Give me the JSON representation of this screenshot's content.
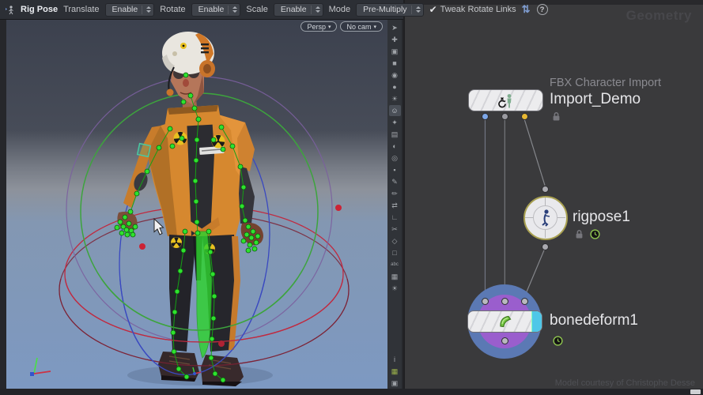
{
  "colors": {
    "toolbar_bg": "#2c2f35",
    "network_bg": "#3a3a3c",
    "watermark": "#47474b",
    "credit": "#4f5055",
    "wire": "#85878c",
    "dot_blue": "#7da7e8",
    "dot_gray": "#9a9aa0",
    "dot_yellow": "#e8b833",
    "node_blue": "#5b79b4",
    "node_purple": "#9a5ecd",
    "node_cyan": "#4fc7e8",
    "ring_olive": "#a8a050",
    "suit_orange": "#d6882f",
    "control_green": "#2ee22e",
    "ring_green": "#3da43d",
    "ring_red": "#c02a40",
    "ring_blue": "#3a49c0",
    "ring_purple": "#7b5f9e"
  },
  "toolbar": {
    "tool_label": "Rig Pose",
    "groups": [
      {
        "label": "Translate",
        "value": "Enable"
      },
      {
        "label": "Rotate",
        "value": "Enable"
      },
      {
        "label": "Scale",
        "value": "Enable"
      },
      {
        "label": "Mode",
        "value": "Pre-Multiply"
      }
    ],
    "tweak_checkbox": {
      "checked": true,
      "mark": "✔",
      "label": "Tweak Rotate Links"
    },
    "help_glyph": "?",
    "sort_glyph": "⇅"
  },
  "viewport": {
    "pills": [
      {
        "label": "Persp",
        "chevron": "▾"
      },
      {
        "label": "No cam",
        "chevron": "▾"
      }
    ],
    "right_toolbar": {
      "top": [
        {
          "name": "select-icon",
          "glyph": "➤"
        },
        {
          "name": "pan-view-icon",
          "glyph": "✚"
        },
        {
          "name": "zoom-region-icon",
          "glyph": "▣"
        },
        {
          "name": "lock-camera-icon",
          "glyph": "■"
        },
        {
          "name": "visibility-icon",
          "glyph": "◉"
        },
        {
          "name": "shaded-mode-icon",
          "glyph": "●"
        },
        {
          "name": "lighting-icon",
          "glyph": "☀"
        },
        {
          "name": "ghost-objects-icon",
          "glyph": "☺",
          "active": true
        },
        {
          "name": "skeleton-display-icon",
          "glyph": "✦"
        },
        {
          "name": "image-plane-icon",
          "glyph": "▤"
        },
        {
          "name": "material-sphere-icon",
          "glyph": "◐"
        },
        {
          "name": "normals-icon",
          "glyph": "◎"
        },
        {
          "name": "points-display-icon",
          "glyph": "▪"
        },
        {
          "name": "brush-icon",
          "glyph": "✎"
        },
        {
          "name": "pencil-icon",
          "glyph": "✏"
        },
        {
          "name": "transform-arrows-icon",
          "glyph": "⇄"
        },
        {
          "name": "measure-icon",
          "glyph": "∟"
        },
        {
          "name": "snip-icon",
          "glyph": "✂"
        }
      ],
      "middle": [
        {
          "name": "mirror-icon",
          "glyph": "◇"
        },
        {
          "name": "stop-icon",
          "glyph": "□"
        },
        {
          "name": "text-overlay-icon",
          "glyph": "abc"
        },
        {
          "name": "background-image-icon",
          "glyph": "▦"
        },
        {
          "name": "headlight-icon",
          "glyph": "☀"
        }
      ],
      "bottom": [
        {
          "name": "info-icon",
          "glyph": "i"
        },
        {
          "name": "grid-snap-icon",
          "glyph": "▦",
          "color": "#9ab04a"
        },
        {
          "name": "snapshot-icon",
          "glyph": "▣"
        }
      ]
    }
  },
  "network_editor": {
    "watermark": "Geometry",
    "credit": "Model courtesy of Christophe Desse",
    "nodes": [
      {
        "id": "import",
        "type_label": "FBX Character Import",
        "name": "Import_Demo",
        "flags": [
          "locked"
        ]
      },
      {
        "id": "rigpose",
        "name": "rigpose1",
        "flags": [
          "locked",
          "time-dependent"
        ]
      },
      {
        "id": "bonedeform",
        "name": "bonedeform1",
        "flags": [
          "time-dependent"
        ]
      }
    ]
  }
}
